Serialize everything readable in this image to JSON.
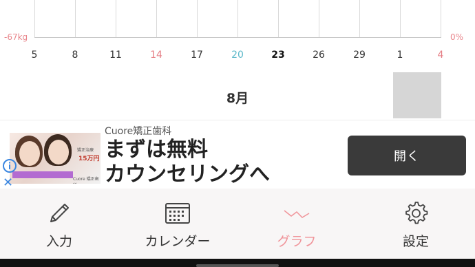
{
  "chart": {
    "left_axis_label": "-67kg",
    "right_axis_label": "0%",
    "ticks": [
      {
        "label": "5",
        "style": "normal"
      },
      {
        "label": "8",
        "style": "normal"
      },
      {
        "label": "11",
        "style": "normal"
      },
      {
        "label": "14",
        "style": "red"
      },
      {
        "label": "17",
        "style": "normal"
      },
      {
        "label": "20",
        "style": "blue"
      },
      {
        "label": "23",
        "style": "bold"
      },
      {
        "label": "26",
        "style": "normal"
      },
      {
        "label": "29",
        "style": "normal"
      },
      {
        "label": "1",
        "style": "normal"
      },
      {
        "label": "4",
        "style": "red"
      }
    ],
    "month_label": "8月"
  },
  "ad": {
    "sponsor": "Cuore矯正歯科",
    "headline_line1": "まずは無料",
    "headline_line2": "カウンセリングへ",
    "open_button": "開く",
    "close_symbol": "✕",
    "image_caption_price": "15万円",
    "image_caption_treatment": "矯正治療",
    "image_caption_brand": "Cuore 矯正歯科"
  },
  "nav": {
    "items": [
      {
        "label": "入力",
        "icon": "pencil-icon"
      },
      {
        "label": "カレンダー",
        "icon": "calendar-icon"
      },
      {
        "label": "グラフ",
        "icon": "graph-icon",
        "active": true
      },
      {
        "label": "設定",
        "icon": "gear-icon"
      }
    ]
  },
  "colors": {
    "accent_pink": "#f0949a",
    "tick_red": "#e57d84",
    "tick_blue": "#5cb8c9",
    "button_dark": "#3a3a3a",
    "nav_bg": "#f8f6f6"
  }
}
